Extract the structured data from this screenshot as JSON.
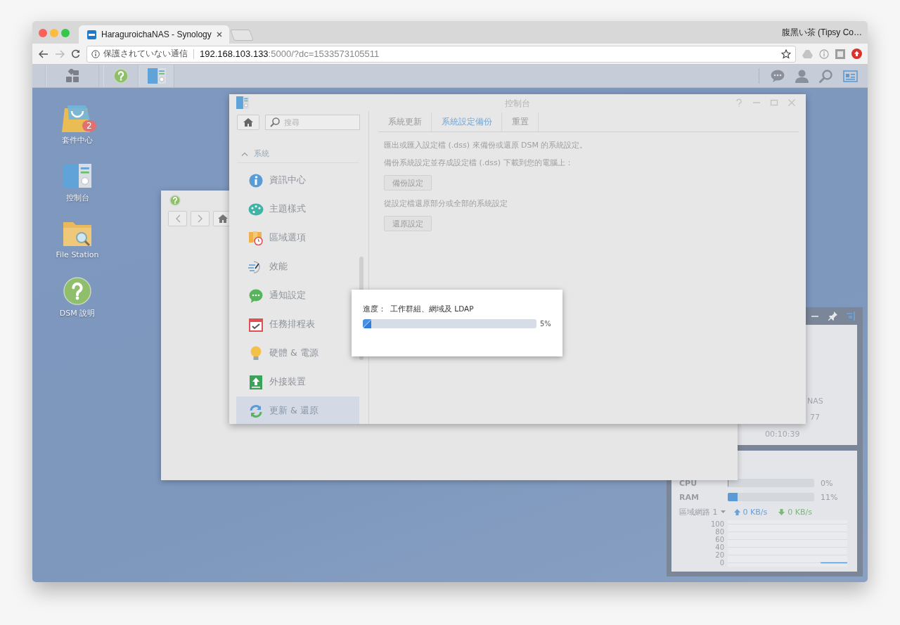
{
  "browser": {
    "tab_title": "HaraguroichaNAS - Synology",
    "profile": "腹黑い茶 (Tipsy Co…",
    "security_label": "保護されていない通信",
    "host": "192.168.103.133",
    "path": ":5000/?dc=1533573105511"
  },
  "desktop_icons": [
    {
      "kind": "package-center",
      "label": "套件中心",
      "badge": "2"
    },
    {
      "kind": "control-panel",
      "label": "控制台"
    },
    {
      "kind": "file-station",
      "label": "File Station"
    },
    {
      "kind": "help",
      "label": "DSM 說明"
    }
  ],
  "control_panel": {
    "title": "控制台",
    "search_placeholder": "搜尋",
    "section": "系統",
    "items": [
      {
        "kind": "info",
        "label": "資訊中心",
        "selected": false
      },
      {
        "kind": "theme",
        "label": "主題樣式",
        "selected": false
      },
      {
        "kind": "regional",
        "label": "區域選項",
        "selected": false
      },
      {
        "kind": "performance",
        "label": "效能",
        "selected": false
      },
      {
        "kind": "notification",
        "label": "通知設定",
        "selected": false
      },
      {
        "kind": "scheduler",
        "label": "任務排程表",
        "selected": false
      },
      {
        "kind": "hardware",
        "label": "硬體 & 電源",
        "selected": false
      },
      {
        "kind": "external",
        "label": "外接裝置",
        "selected": false
      },
      {
        "kind": "update",
        "label": "更新 & 還原",
        "selected": true
      }
    ],
    "tabs": [
      {
        "label": "系統更新",
        "selected": false
      },
      {
        "label": "系統設定備份",
        "selected": true
      },
      {
        "label": "重置",
        "selected": false
      }
    ],
    "content": [
      {
        "kind": "text",
        "text": "匯出或匯入設定檔 (.dss) 來備份或還原 DSM 的系統設定。"
      },
      {
        "kind": "text",
        "text": "備份系統設定並存成設定檔 (.dss) 下載到您的電腦上："
      },
      {
        "kind": "button",
        "text": "備份設定"
      },
      {
        "kind": "text",
        "text": "從設定檔還原部分或全部的系統設定"
      },
      {
        "kind": "button",
        "text": "還原設定"
      }
    ]
  },
  "widget": {
    "system_texts": [
      "NAS",
      "77",
      "00:10:39"
    ],
    "resources": [
      {
        "name": "CPU",
        "level": 0,
        "reading": "0%"
      },
      {
        "name": "RAM",
        "level": 0.11,
        "reading": "11%"
      }
    ],
    "network": {
      "label": "區域網路 1",
      "upload": "0 KB/s",
      "download": "0 KB/s"
    },
    "chart_data": {
      "type": "line",
      "grid": true,
      "ylim": [
        0,
        100
      ],
      "yticks": [
        0,
        20,
        40,
        60,
        80,
        100
      ],
      "series": [
        {
          "color": "#5b9bd5",
          "values": [
            null,
            null,
            null,
            null,
            null,
            null,
            null,
            0,
            0,
            0
          ]
        }
      ]
    }
  },
  "progress_dialog": {
    "label": "進度：",
    "task": "工作群組、網域及 LDAP",
    "level": 0.05,
    "reading": "5%"
  }
}
